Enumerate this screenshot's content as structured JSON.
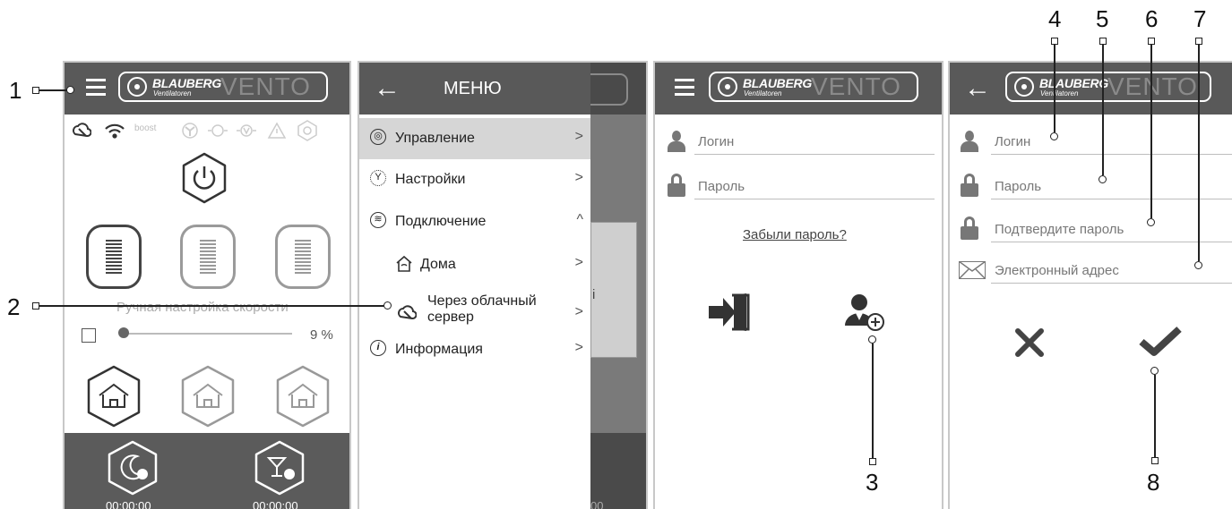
{
  "brand": {
    "name": "BLAUBERG",
    "sub": "Ventilatoren",
    "product": "VENTO"
  },
  "screen1": {
    "status_icons": [
      "cloud-icon",
      "wifi-icon",
      "boost-label",
      "fan-icon",
      "sun-icon",
      "sensor-icon",
      "warning-icon",
      "filter-icon"
    ],
    "boost_label": "boost",
    "speed_label": "Ручная настройка скорости",
    "speed_value": "9 %",
    "speed_level": 0.09,
    "timers": [
      "00:00:00",
      "00:00:00"
    ]
  },
  "menu": {
    "title": "МЕНЮ",
    "items": [
      {
        "label": "Управление",
        "icon": "control-icon",
        "chevron": ">"
      },
      {
        "label": "Настройки",
        "icon": "settings-icon",
        "chevron": ">"
      },
      {
        "label": "Подключение",
        "icon": "wifi-icon",
        "chevron": "^"
      },
      {
        "label": "Дома",
        "icon": "home-icon",
        "chevron": ">"
      },
      {
        "label": "Через облачный",
        "label2": "сервер",
        "icon": "cloud-icon",
        "chevron": ">"
      },
      {
        "label": "Информация",
        "icon": "info-icon",
        "chevron": ">"
      }
    ],
    "overlay_text": "i",
    "overlay_timer": "00"
  },
  "login": {
    "login_placeholder": "Логин",
    "password_placeholder": "Пароль",
    "forgot": "Забыли пароль?"
  },
  "register": {
    "login_placeholder": "Логин",
    "password_placeholder": "Пароль",
    "confirm_placeholder": "Подтвердите пароль",
    "email_placeholder": "Электронный адрес"
  },
  "callouts": [
    "1",
    "2",
    "3",
    "4",
    "5",
    "6",
    "7",
    "8"
  ],
  "colors": {
    "appbar": "#595959",
    "panel_dark": "#5b5b5b",
    "menu_highlight": "#d6d6d6"
  }
}
